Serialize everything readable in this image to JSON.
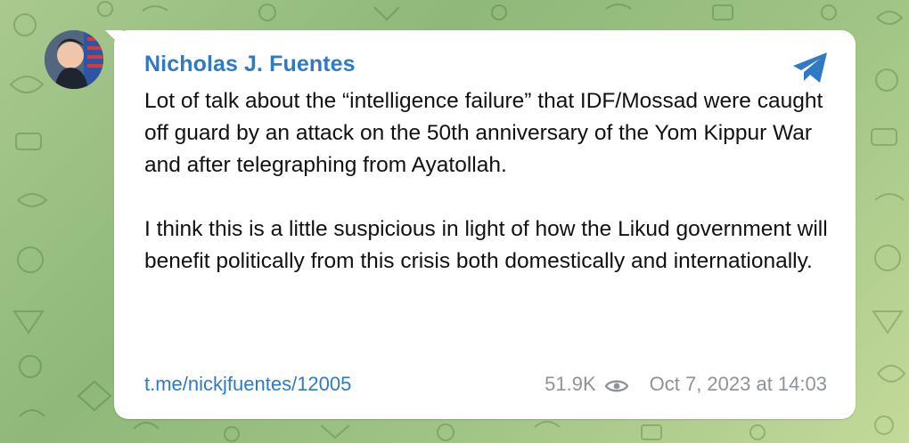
{
  "post": {
    "author_name": "Nicholas J. Fuentes",
    "message_paragraph_1": "Lot of talk about the “intelligence failure” that IDF/Mossad were caught off guard by an attack on the 50th anniversary of the Yom Kippur War and after telegraphing from Ayatollah.",
    "message_paragraph_2": "I think this is a little suspicious in light of how the Likud government will benefit politically from this crisis both domestically and internationally.",
    "link_text": "t.me/nickjfuentes/12005",
    "views": "51.9K",
    "timestamp": "Oct 7, 2023 at 14:03"
  },
  "icons": {
    "share": "telegram-share-icon",
    "views": "eye-icon",
    "avatar": "profile-avatar"
  },
  "colors": {
    "accent": "#2f7ac5",
    "background_green": "#9fc485",
    "text": "#111111",
    "meta_text": "#8d9399"
  }
}
